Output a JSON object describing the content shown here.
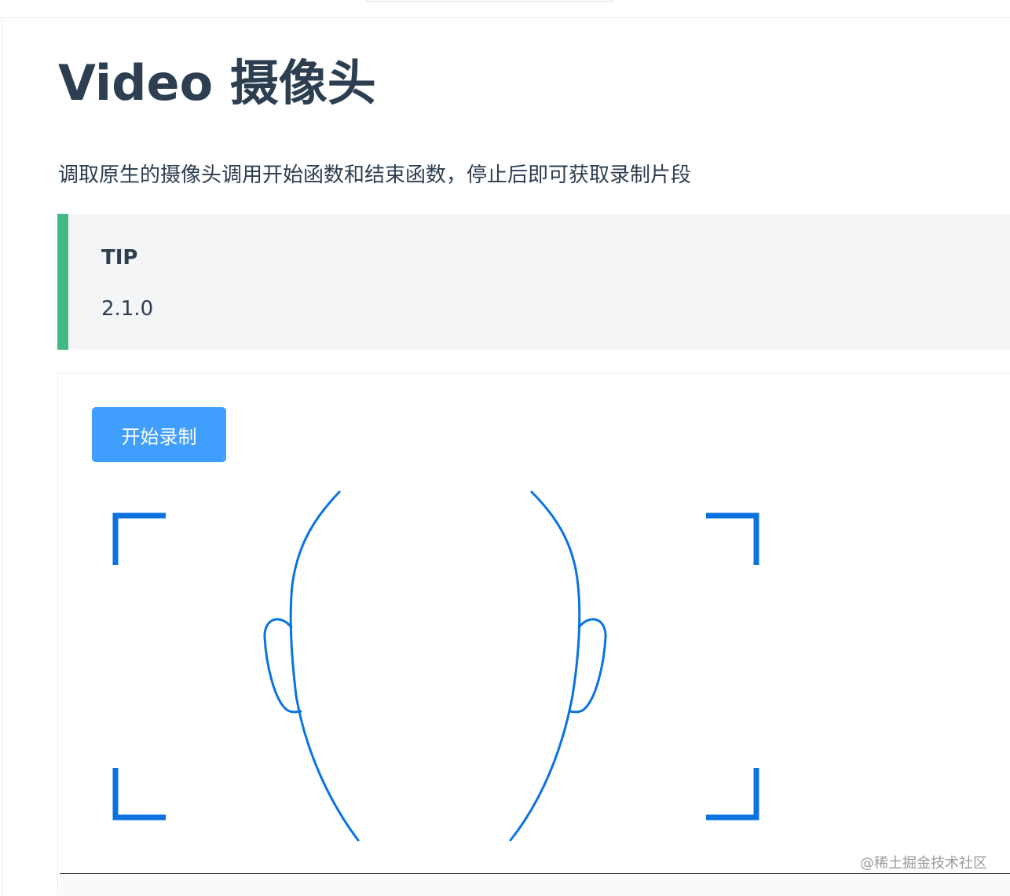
{
  "page": {
    "title": "Video 摄像头",
    "description": "调取原生的摄像头调用开始函数和结束函数，停止后即可获取录制片段"
  },
  "tip": {
    "title": "TIP",
    "text": "2.1.0",
    "accent_color": "#42b983",
    "background_color": "#f3f5f7"
  },
  "demo": {
    "record_button_label": "开始录制",
    "button_color": "#409eff",
    "guide_color": "#0a73e0"
  },
  "watermark": "@稀土掘金技术社区"
}
